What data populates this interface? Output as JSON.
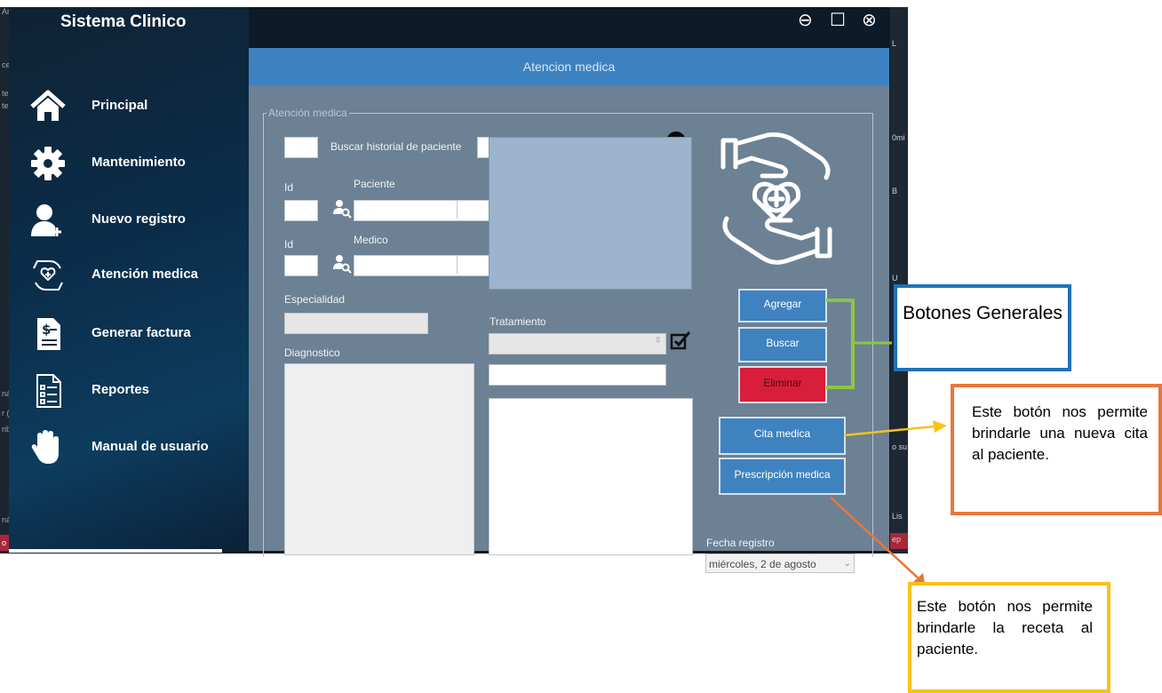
{
  "app": {
    "title": "Sistema Clinico"
  },
  "window_controls": {
    "minimize": "⊖",
    "maximize": "☐",
    "close": "⊗"
  },
  "background_app": {
    "left_fragments": [
      "Arcl",
      "ceso",
      "tenc",
      "tema",
      "nátic",
      "r (Ct",
      "nbre",
      "nátic",
      "o"
    ],
    "right_fragments": [
      "L",
      "0mi",
      "B",
      "U",
      "o su",
      "Lis",
      "ep"
    ]
  },
  "sidebar": {
    "items": [
      {
        "label": "Principal",
        "icon": "home-icon"
      },
      {
        "label": "Mantenimiento",
        "icon": "gear-icon"
      },
      {
        "label": "Nuevo registro",
        "icon": "add-user-icon"
      },
      {
        "label": "Atención medica",
        "icon": "care-hands-icon"
      },
      {
        "label": "Generar factura",
        "icon": "invoice-icon"
      },
      {
        "label": "Reportes",
        "icon": "report-icon"
      },
      {
        "label": "Manual de usuario",
        "icon": "hand-icon"
      }
    ]
  },
  "form": {
    "header": "Atencion medica",
    "group_title": "Atención medica",
    "search_label": "Buscar historial de paciente",
    "id_label": "Id",
    "patient_label": "Paciente",
    "doctor_label": "Medico",
    "specialty_label": "Especialidad",
    "treatment_label": "Tratamiento",
    "diagnosis_label": "Diagnostico",
    "date_label": "Fecha registro",
    "date_value": "miércoles,  2 de   agosto"
  },
  "buttons": {
    "add": "Agregar",
    "search": "Buscar",
    "delete": "Eliminar",
    "appointment": "Cita medica",
    "prescription": "Prescripción medica"
  },
  "annotations": {
    "general_buttons": "Botones Generales",
    "appointment_note": "Este botón nos permite brindarle una nueva cita al paciente.",
    "prescription_note": "Este botón nos permite brindarle la receta al paciente."
  },
  "colors": {
    "accent_blue": "#3f82c0",
    "delete_red": "#d81e3b",
    "panel_gray": "#6c8193",
    "bracket_green": "#8cc63f",
    "note_orange": "#e8773a",
    "note_yellow": "#f7c21a",
    "note_blue": "#1f72b8"
  }
}
